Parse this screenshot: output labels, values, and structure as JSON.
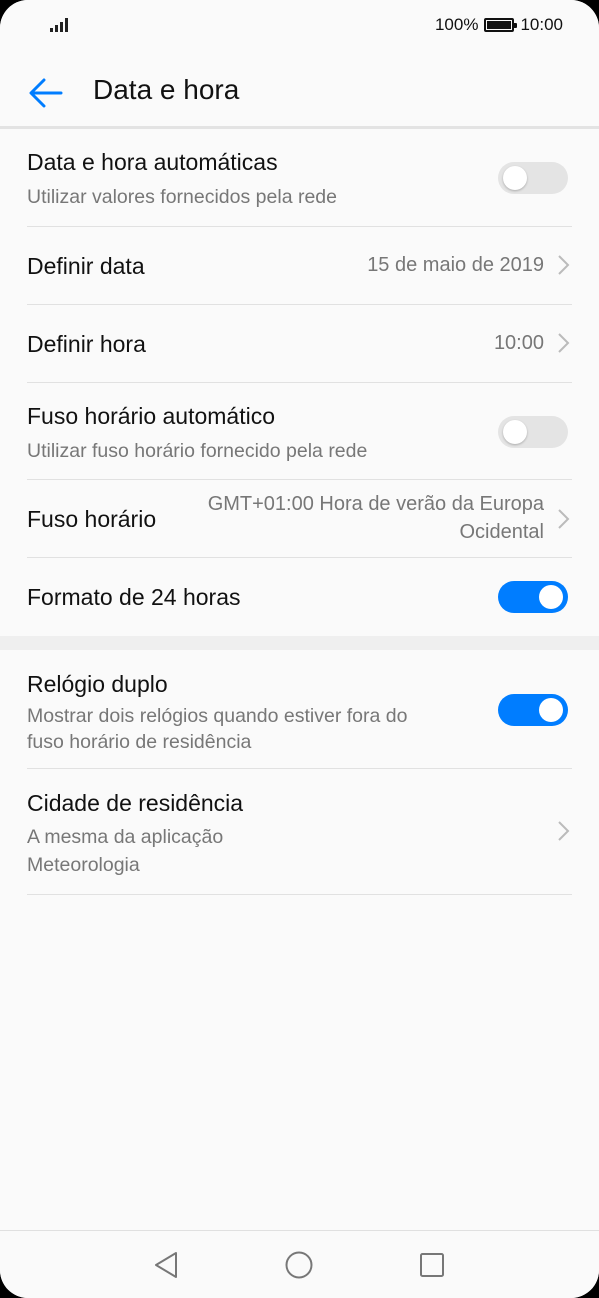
{
  "status_bar": {
    "battery_percent": "100%",
    "time": "10:00",
    "battery_level": 1.0
  },
  "header": {
    "title": "Data e hora",
    "back_icon": "arrow-left-icon"
  },
  "settings": {
    "auto_datetime": {
      "title": "Data e hora automáticas",
      "subtitle": "Utilizar valores fornecidos pela rede",
      "enabled": false
    },
    "set_date": {
      "title": "Definir data",
      "value": "15 de maio de 2019"
    },
    "set_time": {
      "title": "Definir hora",
      "value": "10:00"
    },
    "auto_timezone": {
      "title": "Fuso horário automático",
      "subtitle": "Utilizar fuso horário fornecido pela rede",
      "enabled": false
    },
    "timezone": {
      "title": "Fuso horário",
      "value_line1": "GMT+01:00 Hora de verão da Europa",
      "value_line2": "Ocidental"
    },
    "format_24h": {
      "title": "Formato de 24 horas",
      "enabled": true
    },
    "dual_clock": {
      "title": "Relógio duplo",
      "subtitle_line1": "Mostrar dois relógios quando estiver fora do",
      "subtitle_line2": "fuso horário de residência",
      "enabled": true
    },
    "home_city": {
      "title": "Cidade de residência",
      "subtitle_line1": "A mesma da aplicação",
      "subtitle_line2": "Meteorologia"
    }
  },
  "colors": {
    "accent": "#007dff",
    "toggle_off": "#e4e4e4",
    "background": "#fafafa"
  }
}
